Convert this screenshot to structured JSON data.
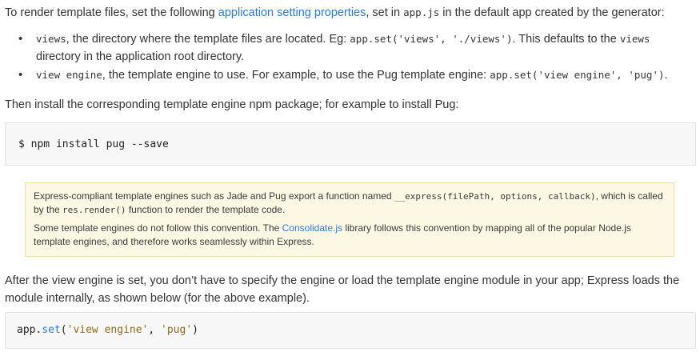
{
  "intro": {
    "t1": "To render template files, set the following ",
    "link": "application setting properties",
    "t2": ", set in ",
    "code": "app.js",
    "t3": " in the default app created by the generator:"
  },
  "options": [
    {
      "name": "views",
      "t1": ", the directory where the template files are located. Eg: ",
      "code": "app.set('views', './views')",
      "t2": ". This defaults to the ",
      "code2": "views",
      "t3": " directory in the application root directory."
    },
    {
      "name": "view engine",
      "t1": ", the template engine to use. For example, to use the Pug template engine: ",
      "code": "app.set('view engine', 'pug')",
      "t2": "."
    }
  ],
  "install_text": "Then install the corresponding template engine npm package; for example to install Pug:",
  "npm_command": "$ npm install pug --save",
  "note": {
    "p1_t1": "Express-compliant template engines such as Jade and Pug export a function named ",
    "p1_code": "__express(filePath, options, callback)",
    "p1_t2": ", which is called by the ",
    "p1_code2": "res.render()",
    "p1_t3": " function to render the template code.",
    "p2_t1": "Some template engines do not follow this convention. The ",
    "p2_link": "Consolidate.js",
    "p2_t2": " library follows this convention by mapping all of the popular Node.js template engines, and therefore works seamlessly within Express."
  },
  "after_text": "After the view engine is set, you don’t have to specify the engine or load the template engine module in your app; Express loads the module internally, as shown below (for the above example).",
  "code_example": {
    "obj": "app",
    "dot": ".",
    "method": "set",
    "open": "(",
    "arg1": "'view engine'",
    "sep": ", ",
    "arg2": "'pug'",
    "close": ")"
  },
  "colors": {
    "link": "#2a7ae2",
    "note_bg": "#fcf8e3",
    "code_bg": "#f7f7f7"
  }
}
